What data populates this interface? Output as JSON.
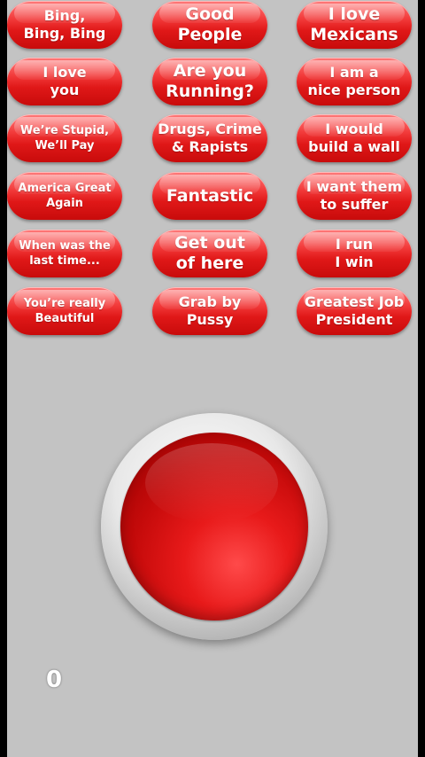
{
  "buttons": [
    [
      "Bing,\nBing, Bing",
      "Good\nPeople",
      "I love\nMexicans"
    ],
    [
      "I love\nyou",
      "Are you\nRunning?",
      "I am a\nnice person"
    ],
    [
      "We’re Stupid,\nWe’ll Pay",
      "Drugs, Crime\n& Rapists",
      "I would\nbuild a wall"
    ],
    [
      "America Great\nAgain",
      "Fantastic",
      "I want them\nto suffer"
    ],
    [
      "When was the\nlast time...",
      "Get out\nof here",
      "I run\nI win"
    ],
    [
      "You’re really\nBeautiful",
      "Grab by\nPussy",
      "Greatest Job\nPresident"
    ]
  ],
  "counter": "0",
  "colors": {
    "button_red": "#e01818",
    "background_gray": "#c3c3c3",
    "frame_black": "#000000"
  }
}
